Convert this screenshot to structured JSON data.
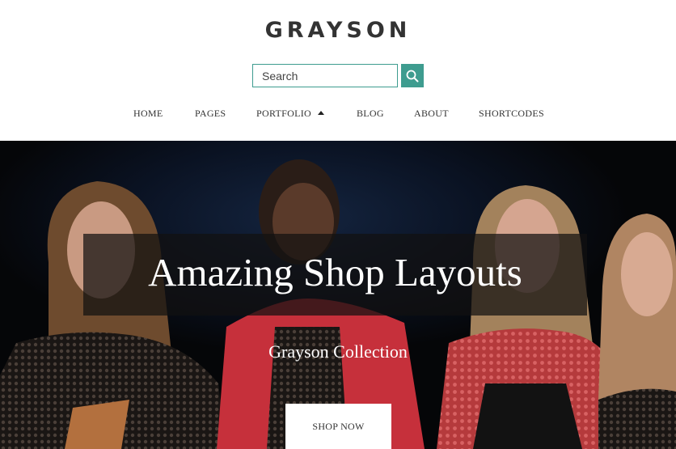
{
  "brand": {
    "logo": "GRAYSON",
    "accent_color": "#3e9c8f"
  },
  "search": {
    "placeholder": "Search",
    "value": "",
    "button_icon": "search-icon"
  },
  "nav": {
    "items": [
      {
        "label": "HOME"
      },
      {
        "label": "PAGES"
      },
      {
        "label": "PORTFOLIO",
        "icon": "caret-up-icon"
      },
      {
        "label": "BLOG"
      },
      {
        "label": "ABOUT"
      },
      {
        "label": "SHORTCODES"
      }
    ]
  },
  "hero": {
    "title": "Amazing Shop Layouts",
    "subtitle": "Grayson Collection",
    "button_label": "SHOP NOW"
  }
}
